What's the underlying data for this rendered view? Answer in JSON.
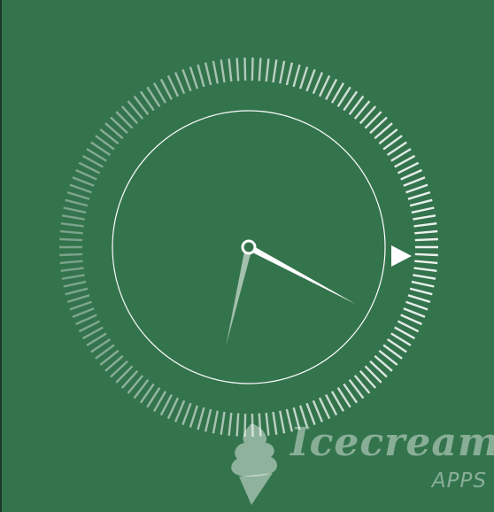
{
  "app": {
    "background_color": "#34744d"
  },
  "clock": {
    "time_display": "analog",
    "hour_hand_angle_deg": 118,
    "minute_hand_angle_deg": 193,
    "indicator_icon": "play-triangle-icon",
    "ring_color": "#ffffff"
  },
  "brand": {
    "wordmark": "Icecream",
    "sub": "APPS",
    "icon": "ice-cream-cone-icon"
  }
}
